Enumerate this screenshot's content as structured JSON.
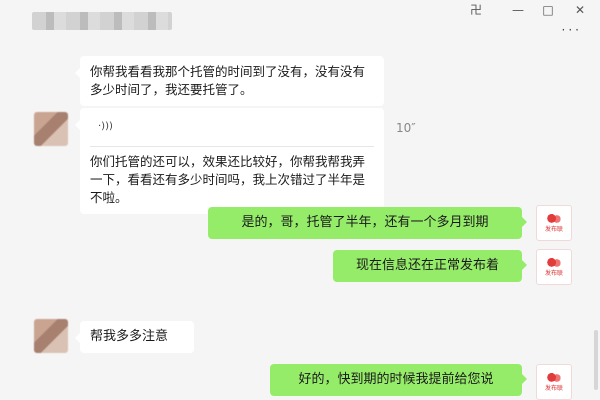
{
  "window": {
    "pin_glyph": "卍",
    "minimize_glyph": "—",
    "maximize_glyph": "□",
    "close_glyph": "✕",
    "more_glyph": "···"
  },
  "self_avatar": {
    "logo_text": "发布联"
  },
  "messages": [
    {
      "sender": "peer",
      "text": "你帮我看看我那个托管的时间到了没有，没有没有多少时间了，我还要托管了。"
    },
    {
      "sender": "peer",
      "type": "voice",
      "voice_glyph": "·)))",
      "duration": "10″",
      "text": "你们托管的还可以，效果还比较好，你帮我帮我弄一下，看看还有多少时间吗，我上次错过了半年是不啦。"
    },
    {
      "sender": "self",
      "text": "是的，哥，托管了半年，还有一个多月到期"
    },
    {
      "sender": "self",
      "text": "现在信息还在正常发布着"
    },
    {
      "sender": "peer",
      "text": "帮我多多注意"
    },
    {
      "sender": "self",
      "text": "好的，快到期的时候我提前给您说"
    }
  ],
  "colors": {
    "self_bubble": "#95ec69",
    "peer_bubble": "#ffffff",
    "background": "#f5f5f5"
  }
}
